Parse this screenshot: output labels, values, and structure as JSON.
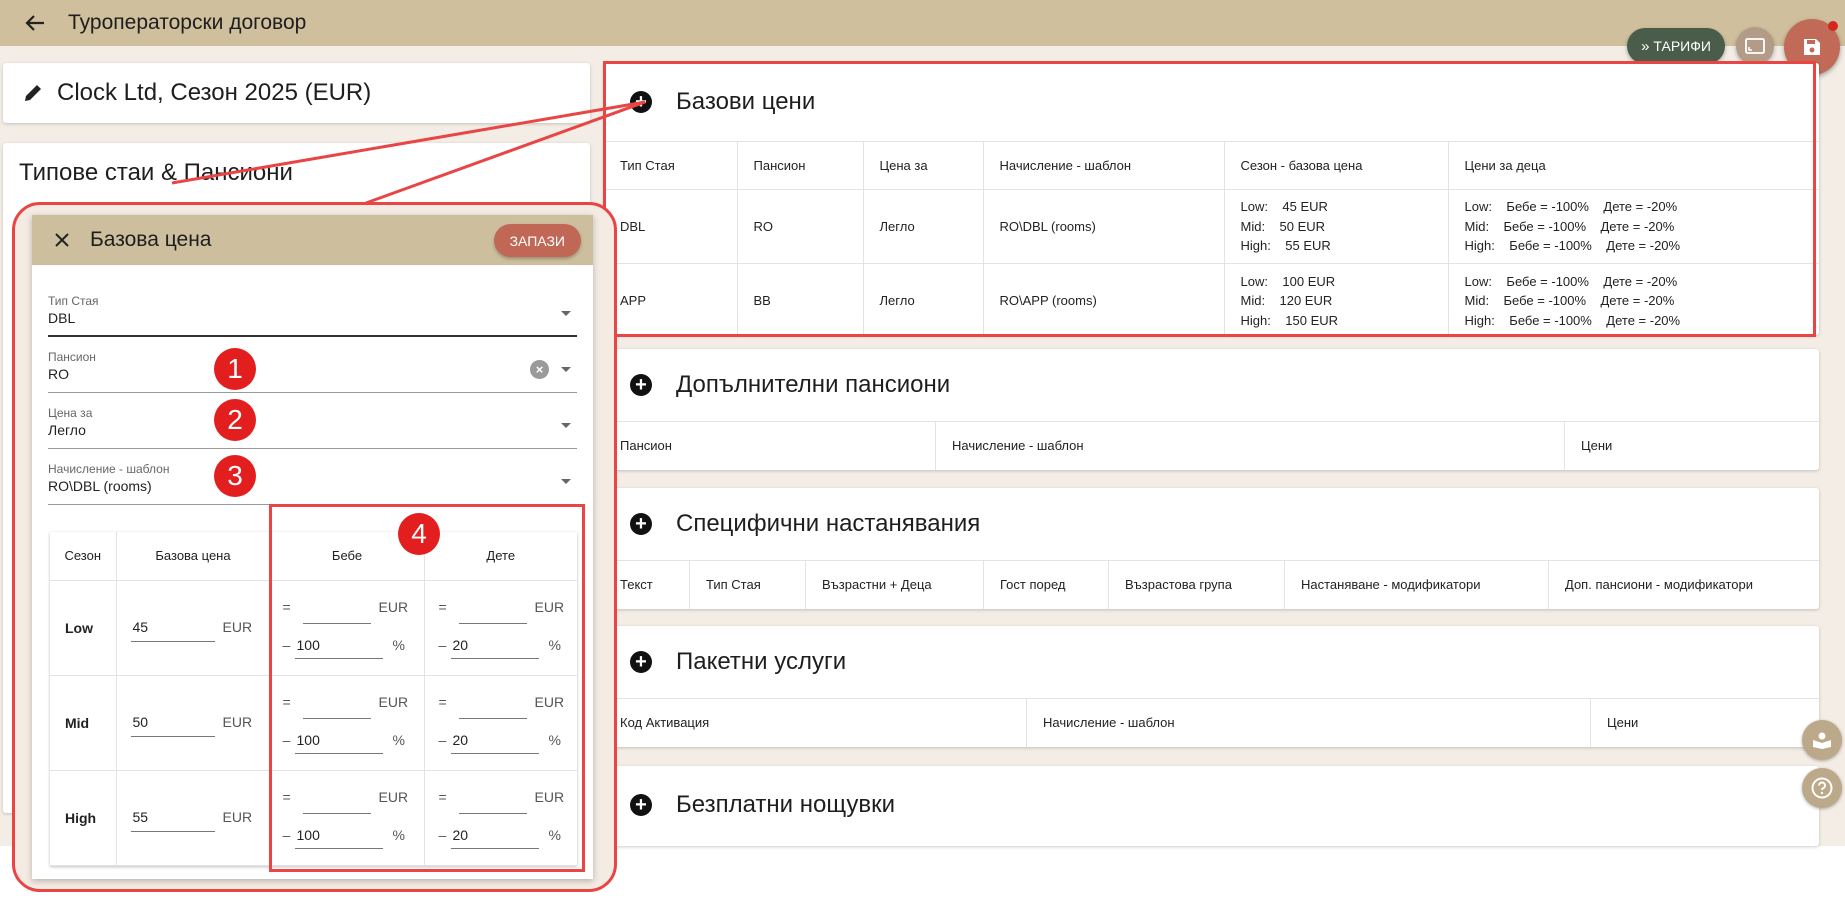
{
  "header": {
    "title": "Туроператорски договор"
  },
  "contract": {
    "title": "Clock Ltd, Сезон 2025 (EUR)"
  },
  "rooms_card": {
    "title": "Типове стаи & Пансиони"
  },
  "fabs": {
    "tariffs_label": "ТАРИФИ"
  },
  "base_prices": {
    "title": "Базови цени",
    "columns": [
      "Тип Стая",
      "Пансион",
      "Цена за",
      "Начисление - шаблон",
      "Сезон - базова цена",
      "Цени за деца"
    ],
    "rows": [
      {
        "room": "DBL",
        "board": "RO",
        "price_for": "Легло",
        "template": "RO\\DBL (rooms)",
        "season_prices": "Low:    45 EUR\nMid:    50 EUR\nHigh:    55 EUR",
        "child_prices": "Low:    Бебе = -100%    Дете = -20%\nMid:    Бебе = -100%    Дете = -20%\nHigh:    Бебе = -100%    Дете = -20%"
      },
      {
        "room": "APP",
        "board": "BB",
        "price_for": "Легло",
        "template": "RO\\APP (rooms)",
        "season_prices": "Low:    100 EUR\nMid:    120 EUR\nHigh:    150 EUR",
        "child_prices": "Low:    Бебе = -100%    Дете = -20%\nMid:    Бебе = -100%    Дете = -20%\nHigh:    Бебе = -100%    Дете = -20%"
      }
    ]
  },
  "extra_boards": {
    "title": "Допълнителни пансиони",
    "columns": [
      "Пансион",
      "Начисление - шаблон",
      "Цени"
    ]
  },
  "specific_accommodations": {
    "title": "Специфични настанявания",
    "columns": [
      "Текст",
      "Тип Стая",
      "Възрастни + Деца",
      "Гост поред",
      "Възрастова група",
      "Настаняване - модификатори",
      "Доп. пансиони - модификатори"
    ]
  },
  "package_services": {
    "title": "Пакетни услуги",
    "columns": [
      "Код Активация",
      "Начисление - шаблон",
      "Цени"
    ]
  },
  "free_nights": {
    "title": "Безплатни нощувки"
  },
  "dialog": {
    "title": "Базова цена",
    "save_label": "ЗАПАЗИ",
    "fields": {
      "room_type": {
        "label": "Тип Стая",
        "value": "DBL"
      },
      "board": {
        "label": "Пансион",
        "value": "RO"
      },
      "price_for": {
        "label": "Цена за",
        "value": "Легло"
      },
      "template": {
        "label": "Начисление - шаблон",
        "value": "RO\\DBL (rooms)"
      }
    },
    "season_table": {
      "columns": [
        "Сезон",
        "Базова цена",
        "Бебе",
        "Дете"
      ],
      "currency": "EUR",
      "percent": "%",
      "eq": "=",
      "minus": "–",
      "rows": [
        {
          "season": "Low",
          "base": "45",
          "baby_pct": "100",
          "child_pct": "20"
        },
        {
          "season": "Mid",
          "base": "50",
          "baby_pct": "100",
          "child_pct": "20"
        },
        {
          "season": "High",
          "base": "55",
          "baby_pct": "100",
          "child_pct": "20"
        }
      ]
    }
  },
  "annotations": {
    "b1": "1",
    "b2": "2",
    "b3": "3",
    "b4": "4"
  },
  "colors": {
    "accent_header": "#cfbf9c",
    "save_red": "#c26a58",
    "highlight": "#e94545",
    "tariffs_green": "#4a5c4a"
  }
}
